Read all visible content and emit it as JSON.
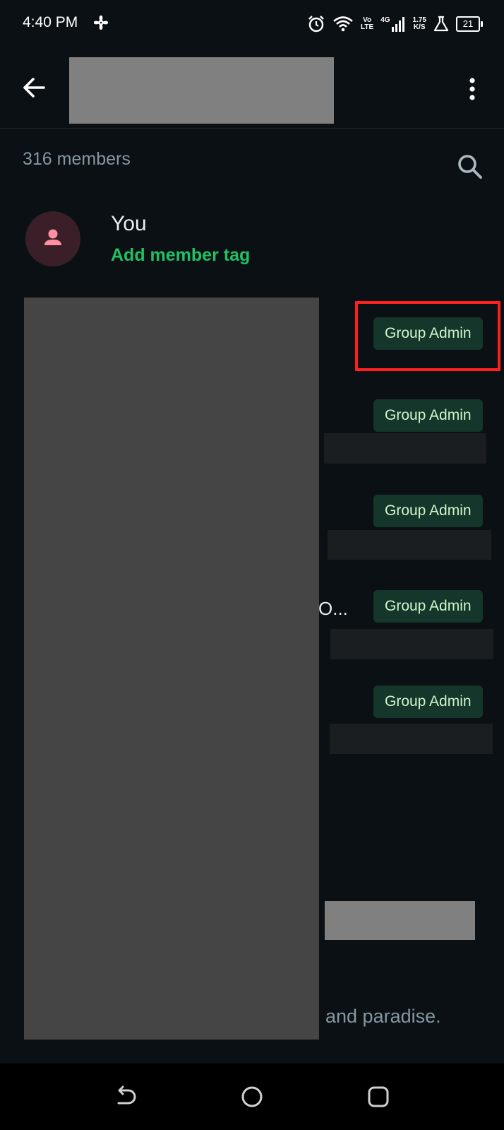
{
  "status_bar": {
    "time": "4:40 PM",
    "volte": [
      "Vo",
      "LTE"
    ],
    "network": "4G",
    "speed": [
      "1.75",
      "K/S"
    ],
    "battery": "21",
    "icons": [
      "fan-icon",
      "alarm-icon",
      "wifi-icon",
      "signal-icon",
      "flask-icon",
      "battery-icon"
    ]
  },
  "app_bar": {
    "back_icon": "arrow-left-icon",
    "menu_icon": "more-vertical-icon"
  },
  "members": {
    "count_label": "316 members",
    "search_icon": "search-icon"
  },
  "you": {
    "name": "You",
    "tag_action": "Add member tag"
  },
  "list": {
    "badges": [
      "Group Admin",
      "Group Admin",
      "Group Admin",
      "Group Admin",
      "Group Admin"
    ],
    "partial_text": "O...",
    "tail_text": "and paradise."
  },
  "nav_bar": {
    "icons": [
      "back-icon",
      "home-icon",
      "recents-icon"
    ]
  },
  "colors": {
    "background": "#0b1014",
    "accent_green": "#21c063",
    "badge_bg": "#15362a",
    "badge_text": "#d1f4cc",
    "highlight": "#ff1f1f"
  }
}
